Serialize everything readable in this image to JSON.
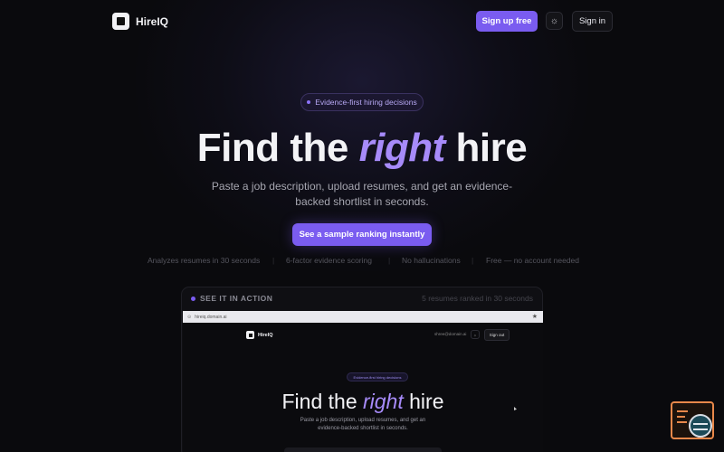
{
  "nav": {
    "brand": "HireIQ",
    "signup_label": "Sign up free",
    "theme_icon": "sun-icon",
    "signin_label": "Sign in"
  },
  "hero": {
    "pill_text": "Evidence-first hiring decisions",
    "title_before": "Find the ",
    "title_accent": "right",
    "title_after": " hire",
    "subtitle": "Paste a job description, upload resumes, and get an evidence-backed shortlist in seconds.",
    "cta_label": "See a sample ranking instantly",
    "features": [
      "Analyzes resumes in 30 seconds",
      "6-factor evidence scoring",
      "No hallucinations",
      "Free — no account needed"
    ]
  },
  "demo": {
    "label": "SEE IT IN ACTION",
    "count": "5 resumes ranked in 30 seconds",
    "browser": {
      "url": "hireiq.domain.ai",
      "brand": "HireIQ",
      "email": "shree@domain.ai",
      "signout_label": "Sign out",
      "pill_text": "Evidence-first hiring decisions",
      "title_before": "Find the ",
      "title_accent": "right",
      "title_after": " hire",
      "subtitle": "Paste a job description, upload resumes, and get an evidence-backed shortlist in seconds."
    }
  },
  "colors": {
    "accent": "#7a5cf0",
    "accent_text": "#a78bfa",
    "background": "#0a0a0d"
  }
}
